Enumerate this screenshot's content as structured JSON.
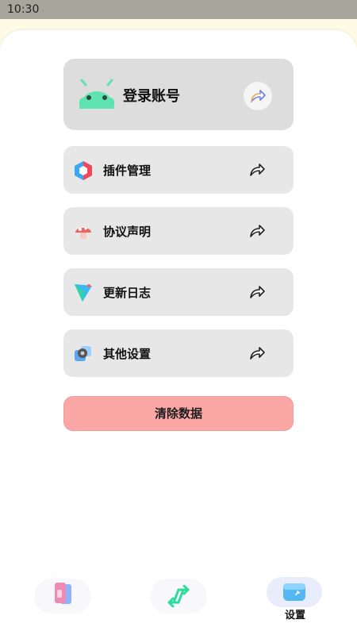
{
  "status_bar": {
    "time": "10:30"
  },
  "account": {
    "label": "登录账号",
    "avatar_icon": "android-robot-icon",
    "action_icon": "share-arrow-icon"
  },
  "menu": [
    {
      "label": "插件管理",
      "icon": "hexagon-plugin-icon"
    },
    {
      "label": "协议声明",
      "icon": "mushroom-icon"
    },
    {
      "label": "更新日志",
      "icon": "paper-plane-icon"
    },
    {
      "label": "其他设置",
      "icon": "gear-settings-icon"
    }
  ],
  "clear_button": {
    "label": "清除数据",
    "color": "#fba7a6"
  },
  "bottom_nav": {
    "items": [
      {
        "name": "cards",
        "icon": "cards-icon",
        "label": ""
      },
      {
        "name": "transfer",
        "icon": "transfer-arrows-icon",
        "label": ""
      },
      {
        "name": "settings",
        "icon": "wallet-settings-icon",
        "label": "设置",
        "active": true
      }
    ]
  },
  "colors": {
    "accent_green": "#5fe3b1",
    "sheet_bg": "#ffffff",
    "card_bg": "#e7e7e7"
  }
}
